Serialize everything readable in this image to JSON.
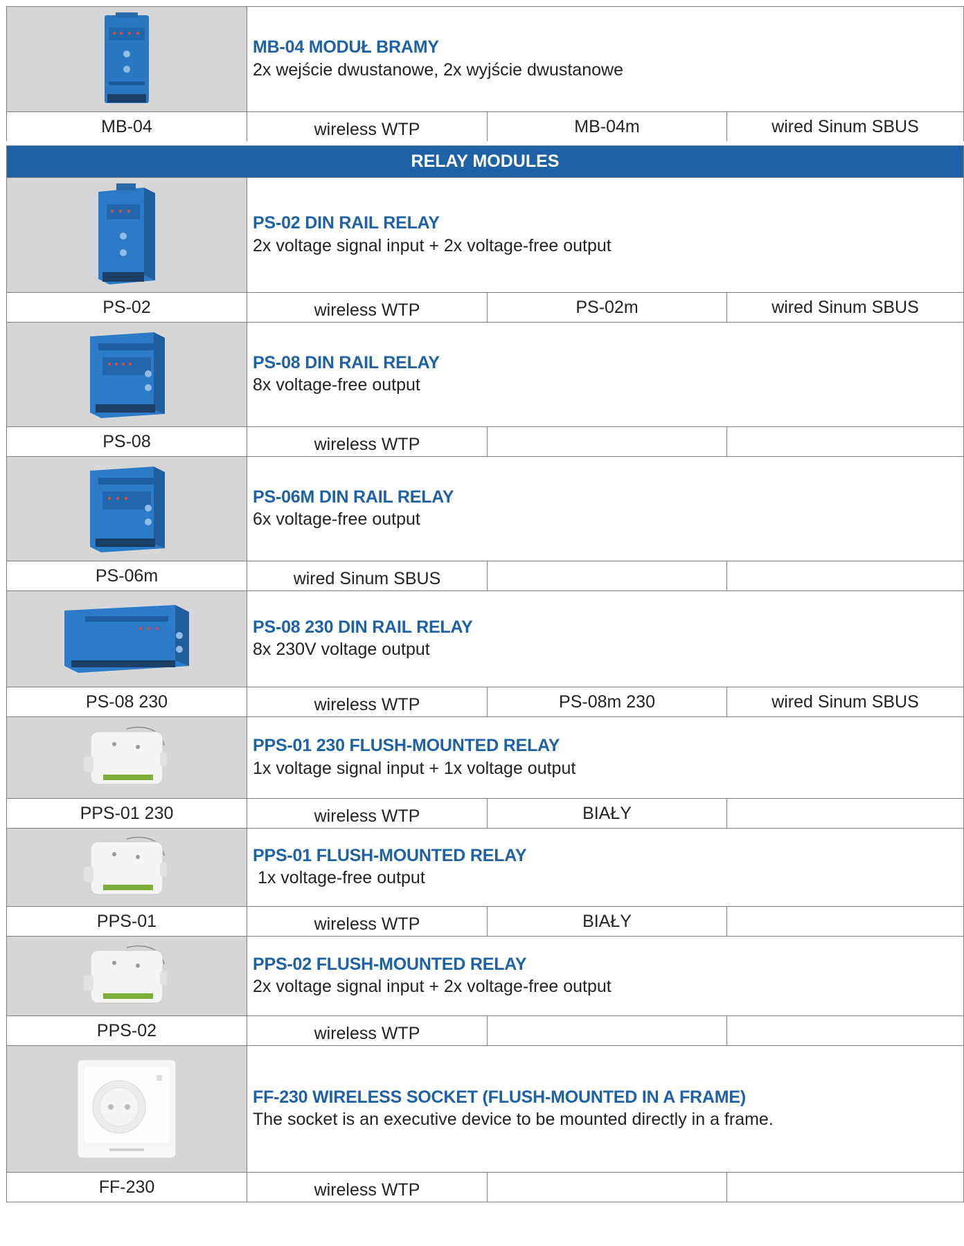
{
  "rows": [
    {
      "title": "MB-04 MODUŁ BRAMY",
      "desc": "2x wejście dwustanowe, 2x wyjście dwustanowe",
      "code": "MB-04",
      "type1": "wireless WTP",
      "code2": "MB-04m",
      "type2": "wired Sinum SBUS",
      "image": "din-module-blue-narrow"
    },
    {
      "title": "PS-02 DIN RAIL RELAY",
      "desc": "2x voltage signal input + 2x voltage-free output",
      "code": "PS-02",
      "type1": "wireless WTP",
      "code2": "PS-02m",
      "type2": "wired Sinum SBUS",
      "image": "din-module-blue-narrow"
    },
    {
      "title": "PS-08 DIN RAIL RELAY",
      "desc": "8x voltage-free output",
      "code": "PS-08",
      "type1": "wireless WTP",
      "code2": "",
      "type2": "",
      "image": "din-module-blue-medium"
    },
    {
      "title": "PS-06M DIN RAIL RELAY",
      "desc": "6x voltage-free output",
      "code": "PS-06m",
      "type1": "wired Sinum SBUS",
      "code2": "",
      "type2": "",
      "image": "din-module-blue-medium"
    },
    {
      "title": "PS-08 230 DIN RAIL RELAY",
      "desc": "8x 230V voltage output",
      "code": "PS-08 230",
      "type1": "wireless WTP",
      "code2": "PS-08m 230",
      "type2": "wired Sinum SBUS",
      "image": "din-module-blue-wide"
    },
    {
      "title": "PPS-01 230 FLUSH-MOUNTED RELAY",
      "desc": "1x voltage signal input + 1x voltage output",
      "code": "PPS-01 230",
      "type1": "wireless WTP",
      "code2": "BIAŁY",
      "type2": "",
      "image": "flush-relay-white"
    },
    {
      "title": "PPS-01 FLUSH-MOUNTED RELAY",
      "desc": " 1x voltage-free output",
      "code": "PPS-01",
      "type1": "wireless WTP",
      "code2": "BIAŁY",
      "type2": "",
      "image": "flush-relay-white"
    },
    {
      "title": "PPS-02 FLUSH-MOUNTED RELAY",
      "desc": "2x voltage signal input + 2x voltage-free output",
      "code": "PPS-02",
      "type1": "wireless WTP",
      "code2": "",
      "type2": "",
      "image": "flush-relay-white"
    },
    {
      "title": "FF-230 WIRELESS SOCKET (FLUSH-MOUNTED IN A FRAME)",
      "desc": "The socket is an executive device to be mounted directly in a frame.",
      "code": "FF-230",
      "type1": "wireless WTP",
      "code2": "",
      "type2": "",
      "image": "wall-socket-white"
    }
  ],
  "section": {
    "title": "RELAY MODULES"
  },
  "colors": {
    "accent": "#1d62a6",
    "image_bg": "#d6d6d6",
    "border": "#7d7d7d"
  }
}
